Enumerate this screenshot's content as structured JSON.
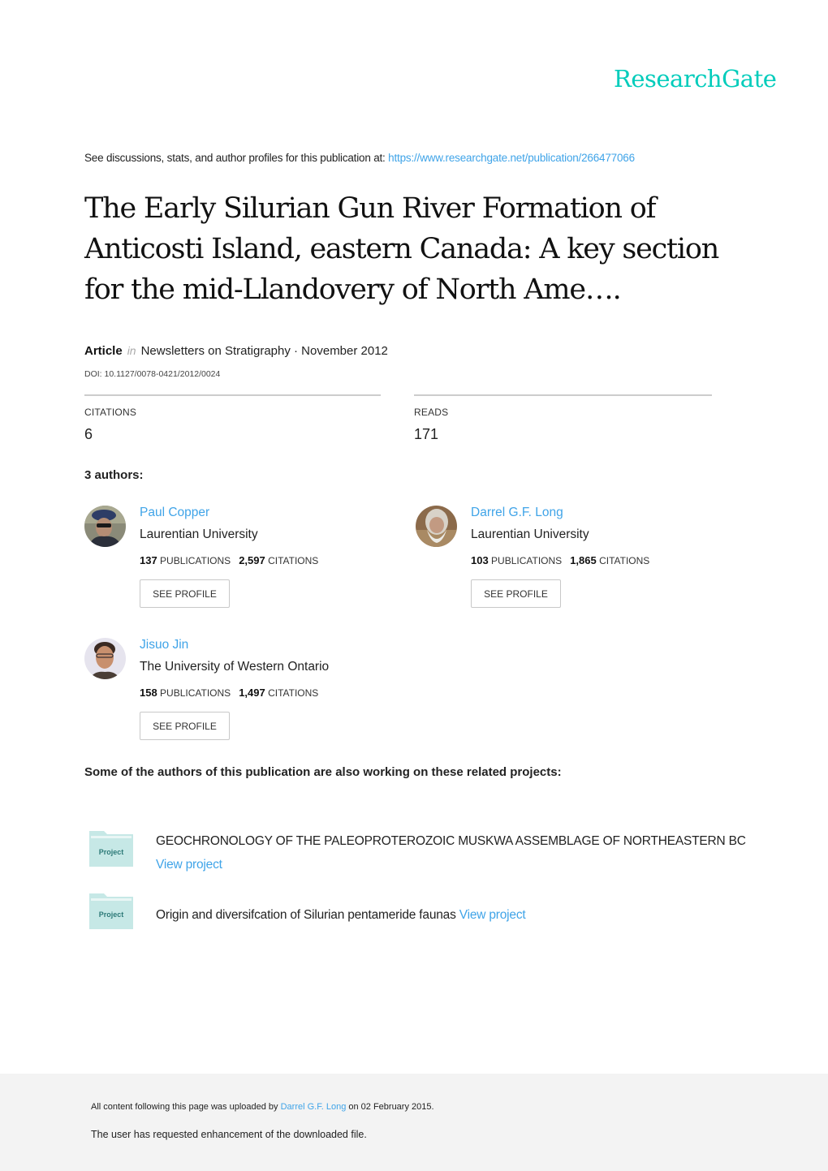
{
  "header": {
    "logo_text": "ResearchGate",
    "logo_color": "#00ccbb",
    "see_discussions_text": "See discussions, stats, and author profiles for this publication at: ",
    "publication_url": "https://www.researchgate.net/publication/266477066"
  },
  "publication": {
    "title": "The Early Silurian Gun River Formation of Anticosti Island, eastern Canada: A key section for the mid-Llandovery of North Ame….",
    "type": "Article",
    "in_label": "in",
    "journal_date": "Newsletters on Stratigraphy · November 2012",
    "doi": "DOI: 10.1127/0078-0421/2012/0024"
  },
  "stats": {
    "citations_label": "CITATIONS",
    "citations_value": "6",
    "reads_label": "READS",
    "reads_value": "171"
  },
  "authors_heading": "3 authors:",
  "authors": [
    {
      "name": "Paul Copper",
      "institution": "Laurentian University",
      "publications_count": "137",
      "publications_label": "PUBLICATIONS",
      "citations_count": "2,597",
      "citations_label": "CITATIONS",
      "button_label": "SEE PROFILE"
    },
    {
      "name": "Darrel G.F. Long",
      "institution": "Laurentian University",
      "publications_count": "103",
      "publications_label": "PUBLICATIONS",
      "citations_count": "1,865",
      "citations_label": "CITATIONS",
      "button_label": "SEE PROFILE"
    },
    {
      "name": "Jisuo Jin",
      "institution": "The University of Western Ontario",
      "publications_count": "158",
      "publications_label": "PUBLICATIONS",
      "citations_count": "1,497",
      "citations_label": "CITATIONS",
      "button_label": "SEE PROFILE"
    }
  ],
  "related": {
    "heading": "Some of the authors of this publication are also working on these related projects:",
    "projects": [
      {
        "icon_label": "Project",
        "title": "GEOCHRONOLOGY OF THE PALEOPROTEROZOIC MUSKWA ASSEMBLAGE OF NORTHEASTERN BC",
        "link_label": "View project"
      },
      {
        "icon_label": "Project",
        "title": "Origin and diversifcation of Silurian pentameride faunas",
        "link_label": "View project"
      }
    ]
  },
  "footer": {
    "uploaded_prefix": "All content following this page was uploaded by ",
    "uploader": "Darrel G.F. Long",
    "uploaded_suffix": " on 02 February 2015.",
    "enhancement_note": "The user has requested enhancement of the downloaded file."
  }
}
